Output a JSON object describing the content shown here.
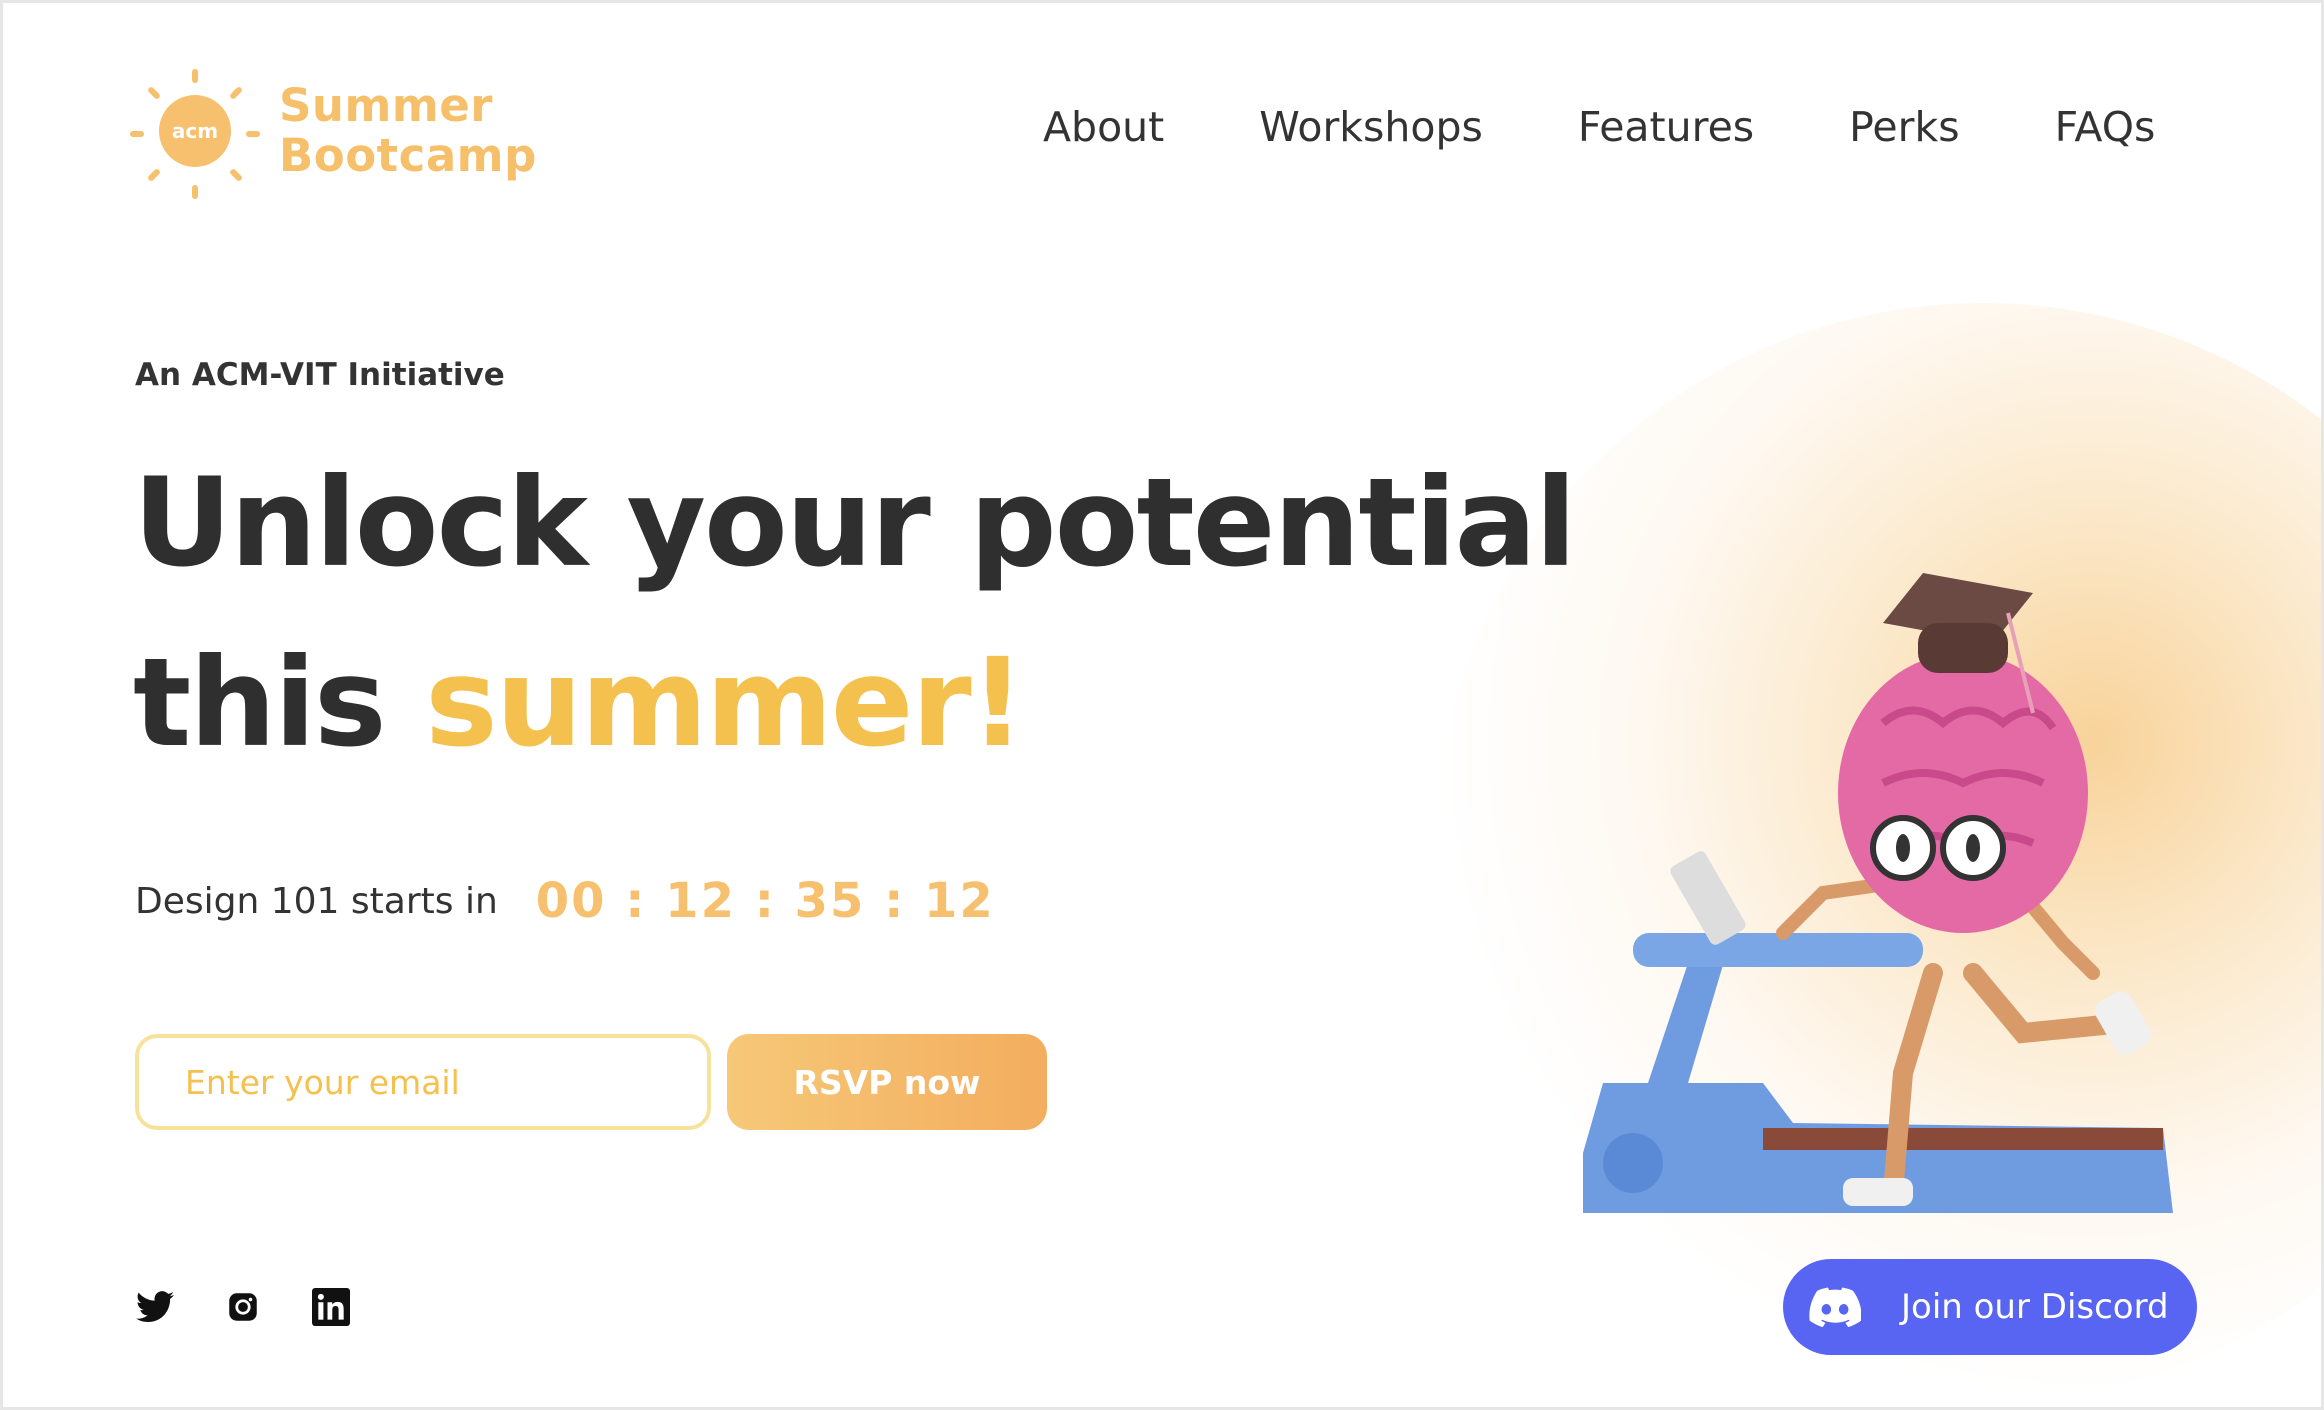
{
  "brand": {
    "logo_mark": "acm",
    "name_line1": "Summer",
    "name_line2": "Bootcamp",
    "accent_color": "#f6c06e"
  },
  "nav": {
    "items": [
      "About",
      "Workshops",
      "Features",
      "Perks",
      "FAQs"
    ]
  },
  "hero": {
    "kicker": "An ACM-VIT Initiative",
    "headline_line1": "Unlock your potential",
    "headline_line2_prefix": "this ",
    "headline_line2_accent": "summer!",
    "headline_accent_color": "#f4c04e"
  },
  "countdown": {
    "label": "Design 101 starts in",
    "timer": "00 : 12 : 35 : 12"
  },
  "rsvp": {
    "email_placeholder": "Enter your email",
    "email_value": "",
    "button_label": "RSVP now"
  },
  "socials": {
    "icons": [
      "twitter-icon",
      "instagram-icon",
      "linkedin-icon"
    ]
  },
  "discord": {
    "label": "Join our Discord",
    "color": "#5865f2"
  },
  "illustration": {
    "icon": "brain-on-treadmill-illustration"
  }
}
